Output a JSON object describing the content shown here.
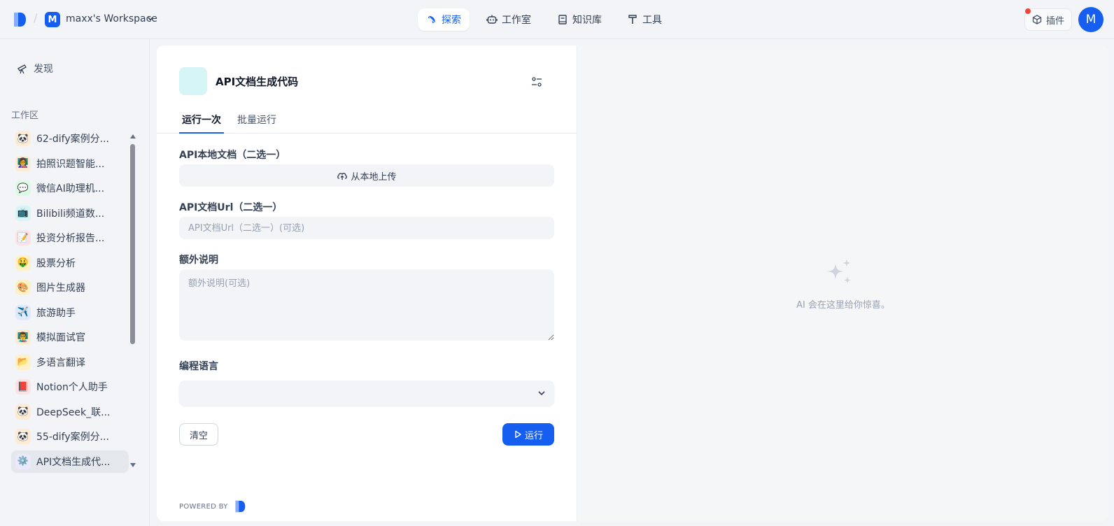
{
  "workspace": {
    "initial": "M",
    "name": "maxx's Workspace"
  },
  "nav": [
    {
      "label": "探索",
      "icon": "compass-icon",
      "active": true
    },
    {
      "label": "工作室",
      "icon": "robot-icon",
      "active": false
    },
    {
      "label": "知识库",
      "icon": "book-icon",
      "active": false
    },
    {
      "label": "工具",
      "icon": "hammer-icon",
      "active": false
    }
  ],
  "header": {
    "plugin_label": "插件",
    "user_initial": "M"
  },
  "sidebar": {
    "discover_label": "发现",
    "section_label": "工作区",
    "apps": [
      {
        "label": "62-dify案例分...",
        "icon": "🐼",
        "bg": "#fdebd3"
      },
      {
        "label": "拍照识题智能...",
        "icon": "👩‍🏫",
        "bg": "#fdebd3"
      },
      {
        "label": "微信AI助理机...",
        "icon": "💬",
        "bg": "#dcfae6"
      },
      {
        "label": "Bilibili频道数...",
        "icon": "📺",
        "bg": "#d5f5f6"
      },
      {
        "label": "投资分析报告...",
        "icon": "📝",
        "bg": "#fde2e4"
      },
      {
        "label": "股票分析",
        "icon": "🤑",
        "bg": "#fef0c7"
      },
      {
        "label": "图片生成器",
        "icon": "🎨",
        "bg": "#fef0c7"
      },
      {
        "label": "旅游助手",
        "icon": "✈️",
        "bg": "#e0eaff"
      },
      {
        "label": "模拟面试官",
        "icon": "👨‍🏫",
        "bg": "#fdebd3"
      },
      {
        "label": "多语言翻译",
        "icon": "📂",
        "bg": "#fef0c7"
      },
      {
        "label": "Notion个人助手",
        "icon": "📕",
        "bg": "#fde2e4"
      },
      {
        "label": "DeepSeek_联...",
        "icon": "🐼",
        "bg": "#fdebd3"
      },
      {
        "label": "55-dify案例分...",
        "icon": "🐼",
        "bg": "#fdebd3"
      },
      {
        "label": "API文档生成代...",
        "icon": "⚙️",
        "bg": "#ebe9fe",
        "selected": true
      }
    ]
  },
  "app": {
    "title": "API文档生成代码",
    "tabs": [
      {
        "label": "运行一次",
        "active": true
      },
      {
        "label": "批量运行",
        "active": false
      }
    ],
    "fields": {
      "local_doc_label": "API本地文档（二选一）",
      "upload_label": "从本地上传",
      "url_label": "API文档Url（二选一）",
      "url_placeholder": "API文档Url（二选一）(可选)",
      "extra_label": "额外说明",
      "extra_placeholder": "额外说明(可选)",
      "lang_label": "编程语言",
      "lang_value": ""
    },
    "clear_label": "清空",
    "run_label": "运行",
    "powered_by": "POWERED BY"
  },
  "result": {
    "hint": "AI 会在这里给你惊喜。"
  },
  "colors": {
    "accent": "#155eef",
    "alert": "#f04438"
  }
}
